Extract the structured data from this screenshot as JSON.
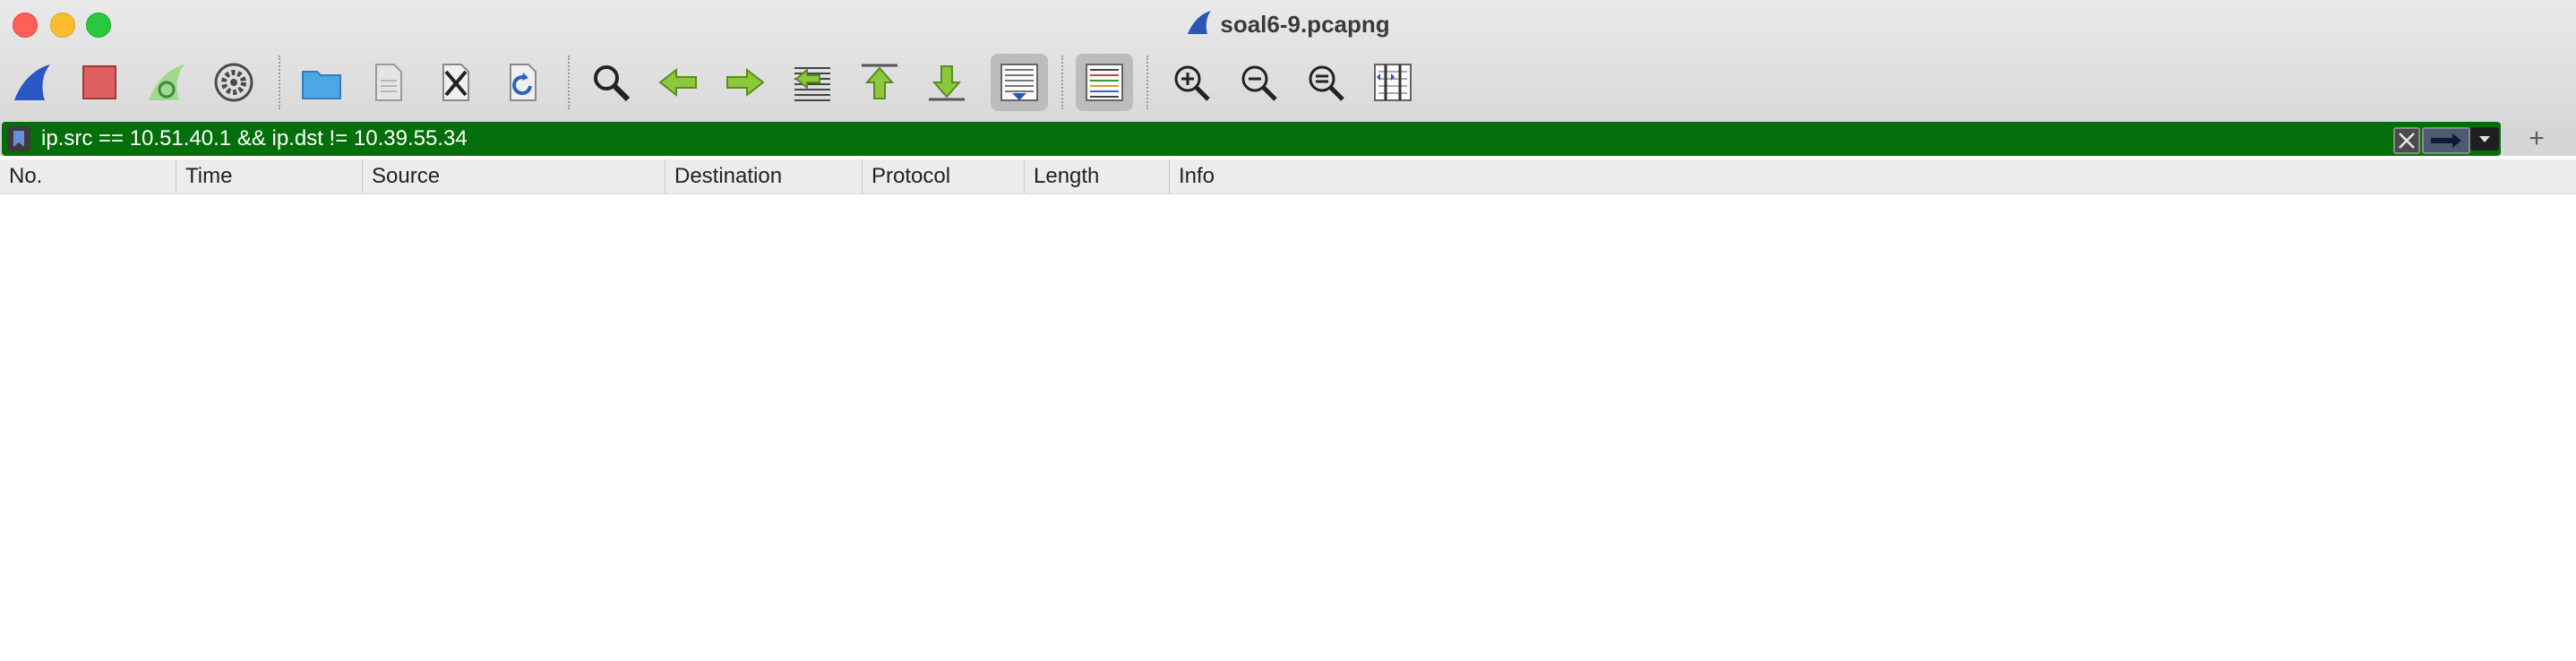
{
  "window": {
    "title": "soal6-9.pcapng"
  },
  "toolbar": {
    "buttons": [
      {
        "name": "start-capture",
        "icon": "shark-fin-icon"
      },
      {
        "name": "stop-capture",
        "icon": "stop-icon"
      },
      {
        "name": "restart-capture",
        "icon": "restart-fin-icon"
      },
      {
        "name": "capture-options",
        "icon": "gear-icon"
      },
      {
        "name": "open-file",
        "icon": "folder-icon"
      },
      {
        "name": "save-file",
        "icon": "document-icon"
      },
      {
        "name": "close-file",
        "icon": "close-file-icon"
      },
      {
        "name": "reload-file",
        "icon": "reload-icon"
      },
      {
        "name": "find-packet",
        "icon": "magnifier-icon"
      },
      {
        "name": "go-back",
        "icon": "arrow-left-icon"
      },
      {
        "name": "go-forward",
        "icon": "arrow-right-icon"
      },
      {
        "name": "go-to-packet",
        "icon": "go-to-packet-icon"
      },
      {
        "name": "first-packet",
        "icon": "arrow-up-bar-icon"
      },
      {
        "name": "last-packet",
        "icon": "arrow-down-bar-icon"
      },
      {
        "name": "autoscroll",
        "icon": "autoscroll-icon",
        "active": true
      },
      {
        "name": "colorize",
        "icon": "colorize-icon",
        "active": true
      },
      {
        "name": "zoom-in",
        "icon": "zoom-in-icon"
      },
      {
        "name": "zoom-out",
        "icon": "zoom-out-icon"
      },
      {
        "name": "zoom-normal",
        "icon": "zoom-reset-icon"
      },
      {
        "name": "resize-columns",
        "icon": "resize-columns-icon"
      }
    ]
  },
  "filter": {
    "value": "ip.src == 10.51.40.1 && ip.dst != 10.39.55.34",
    "background": "#046e0a",
    "plus_label": "+"
  },
  "packet_list": {
    "columns": [
      "No.",
      "Time",
      "Source",
      "Destination",
      "Protocol",
      "Length",
      "Info"
    ],
    "rows": []
  }
}
